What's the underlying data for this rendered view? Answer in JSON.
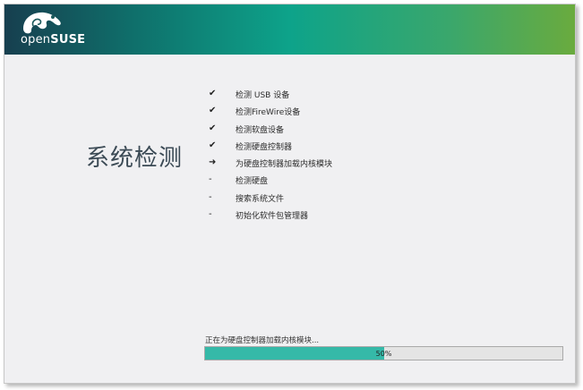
{
  "header": {
    "brand_light": "open",
    "brand_bold": "SUSE",
    "logo_icon": "chameleon-icon"
  },
  "step": {
    "title": "系统检测"
  },
  "steps": [
    {
      "status": "done",
      "mark": "✔",
      "label": "检测 USB 设备"
    },
    {
      "status": "done",
      "mark": "✔",
      "label": "检测FireWire设备"
    },
    {
      "status": "done",
      "mark": "✔",
      "label": "检测软盘设备"
    },
    {
      "status": "done",
      "mark": "✔",
      "label": "检测硬盘控制器"
    },
    {
      "status": "current",
      "mark": "➜",
      "label": "为硬盘控制器加载内核模块"
    },
    {
      "status": "pending",
      "mark": "-",
      "label": "检测硬盘"
    },
    {
      "status": "pending",
      "mark": "-",
      "label": "搜索系统文件"
    },
    {
      "status": "pending",
      "mark": "-",
      "label": "初始化软件包管理器"
    }
  ],
  "progress": {
    "status_text": "正在为硬盘控制器加载内核模块...",
    "percent": 50,
    "label": "50%",
    "fill_color": "#35b9a8"
  },
  "colors": {
    "header_start": "#173f4f",
    "header_end": "#6aab3e",
    "background": "#f0f0f2"
  }
}
